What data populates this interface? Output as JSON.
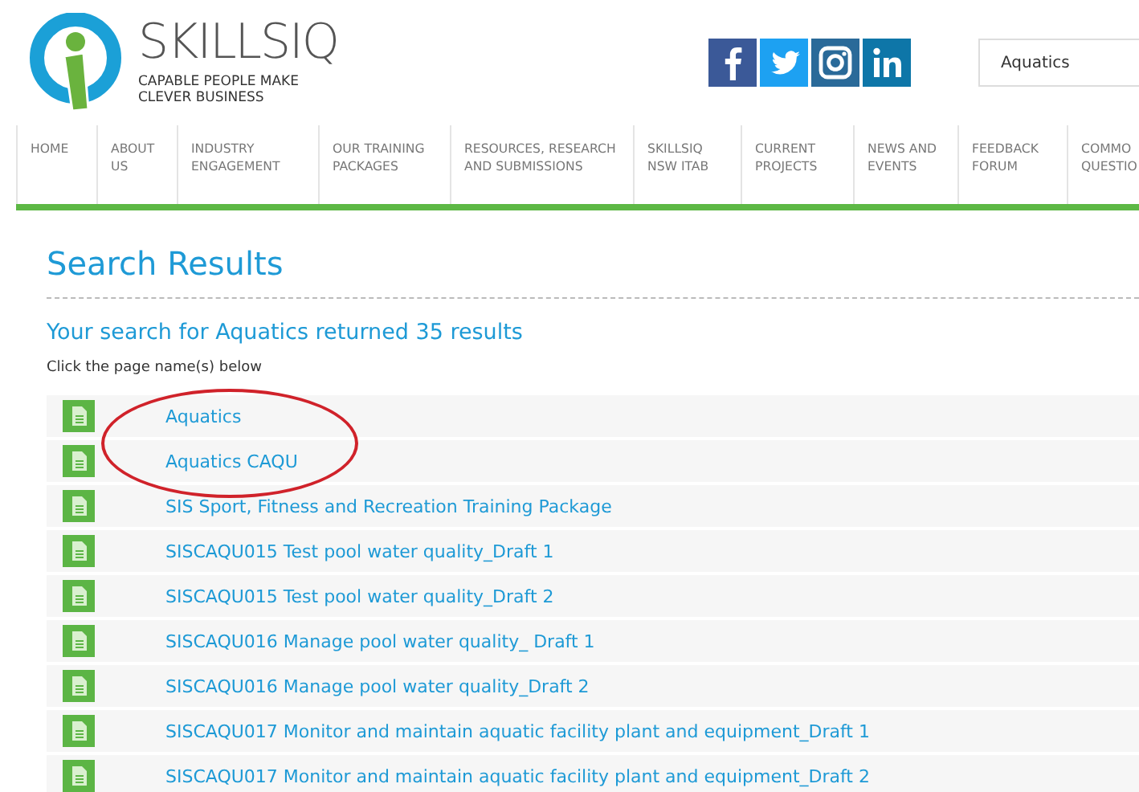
{
  "logo": {
    "name": "SKILLSIQ",
    "tagline": [
      "CAPABLE PEOPLE MAKE",
      "CLEVER BUSINESS"
    ]
  },
  "social": [
    {
      "kind": "facebook"
    },
    {
      "kind": "twitter"
    },
    {
      "kind": "instagram"
    },
    {
      "kind": "linkedin"
    }
  ],
  "search": {
    "value": "Aquatics"
  },
  "nav": [
    {
      "label": [
        "HOME"
      ]
    },
    {
      "label": [
        "ABOUT",
        "US"
      ]
    },
    {
      "label": [
        "INDUSTRY",
        "ENGAGEMENT"
      ]
    },
    {
      "label": [
        "OUR TRAINING",
        "PACKAGES"
      ]
    },
    {
      "label": [
        "RESOURCES, RESEARCH",
        "AND SUBMISSIONS"
      ]
    },
    {
      "label": [
        "SKILLSIQ",
        "NSW ITAB"
      ]
    },
    {
      "label": [
        "CURRENT",
        "PROJECTS"
      ]
    },
    {
      "label": [
        "NEWS AND",
        "EVENTS"
      ]
    },
    {
      "label": [
        "FEEDBACK",
        "FORUM"
      ]
    },
    {
      "label": [
        "COMMO",
        "QUESTIO"
      ]
    }
  ],
  "title": "Search Results",
  "summary": "Your search for Aquatics returned 35 results",
  "hint": "Click the page name(s) below",
  "results": [
    {
      "title": "Aquatics",
      "circled": true
    },
    {
      "title": "Aquatics CAQU",
      "circled": true
    },
    {
      "title": "SIS Sport, Fitness and Recreation Training Package",
      "circled": false
    },
    {
      "title": "SISCAQU015 Test pool water quality_Draft 1",
      "circled": false
    },
    {
      "title": "SISCAQU015 Test pool water quality_Draft 2",
      "circled": false
    },
    {
      "title": "SISCAQU016 Manage pool water quality_ Draft 1",
      "circled": false
    },
    {
      "title": "SISCAQU016 Manage pool water quality_Draft 2",
      "circled": false
    },
    {
      "title": "SISCAQU017 Monitor and maintain aquatic facility plant and equipment_Draft 1",
      "circled": false
    },
    {
      "title": "SISCAQU017 Monitor and maintain aquatic facility plant and equipment_Draft 2",
      "circled": false
    }
  ]
}
